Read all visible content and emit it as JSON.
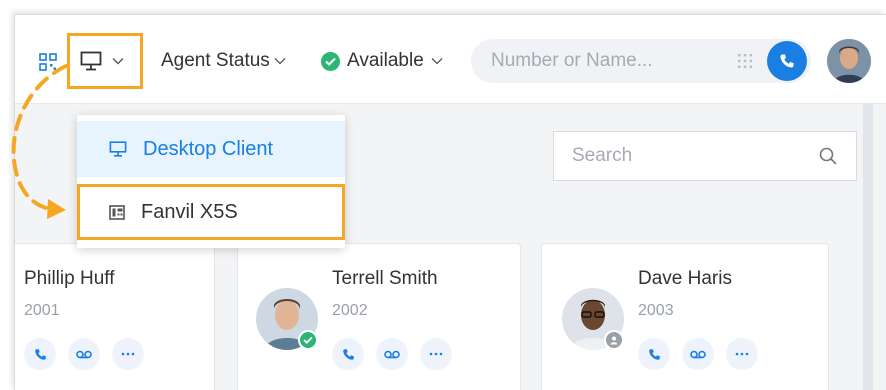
{
  "topbar": {
    "device_icon": "desktop-monitor-icon",
    "agent_status_label": "Agent Status",
    "availability_label": "Available",
    "dial_placeholder": "Number or Name...",
    "colors": {
      "accent": "#1a7ee3",
      "highlight": "#f5a623",
      "available": "#2bb673"
    }
  },
  "device_menu": {
    "items": [
      {
        "label": "Desktop Client",
        "icon": "desktop-monitor-icon",
        "selected": true
      },
      {
        "label": "Fanvil X5S",
        "icon": "ip-phone-icon",
        "selected": false
      }
    ]
  },
  "search": {
    "placeholder": "Search"
  },
  "contacts": [
    {
      "name": "Phillip Huff",
      "ext": "2001"
    },
    {
      "name": "Terrell Smith",
      "ext": "2002",
      "status": "available"
    },
    {
      "name": "Dave Haris",
      "ext": "2003",
      "status": "offline"
    }
  ]
}
